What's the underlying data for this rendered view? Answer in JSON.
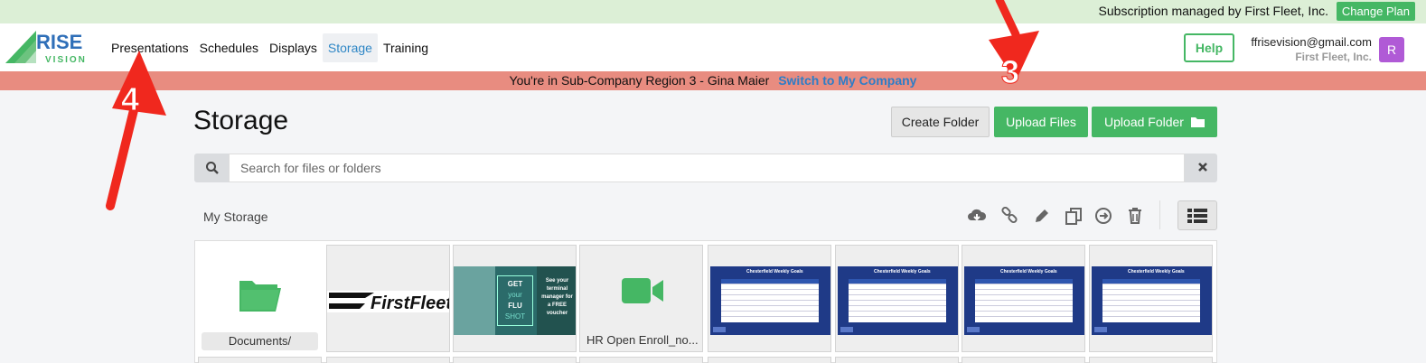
{
  "subscription": {
    "text": "Subscription managed by First Fleet, Inc.",
    "change_plan": "Change Plan"
  },
  "nav": {
    "logo": {
      "word1": "RISE",
      "word2": "VISION"
    },
    "links": [
      "Presentations",
      "Schedules",
      "Displays",
      "Storage",
      "Training"
    ],
    "active": "Storage",
    "help": "Help",
    "user_email": "ffrisevision@gmail.com",
    "user_company": "First Fleet, Inc.",
    "avatar_initial": "R"
  },
  "subcompany": {
    "text": "You're in Sub-Company Region 3 - Gina Maier",
    "switch_link": "Switch to My Company"
  },
  "page": {
    "title": "Storage",
    "create_folder": "Create Folder",
    "upload_files": "Upload Files",
    "upload_folder": "Upload Folder"
  },
  "search": {
    "placeholder": "Search for files or folders"
  },
  "breadcrumb": "My Storage",
  "toolbar_icons": [
    "cloud-download-icon",
    "link-icon",
    "pencil-icon",
    "copy-icon",
    "move-icon",
    "trash-icon",
    "list-view-icon"
  ],
  "files": [
    {
      "name": "Documents/",
      "kind": "folder"
    },
    {
      "name": "",
      "kind": "image-logo",
      "logo_text": "FirstFleet"
    },
    {
      "name": "",
      "kind": "image-flu",
      "text": [
        "GET",
        "your",
        "FLU",
        "SHOT"
      ],
      "side_text": "See your terminal manager for a FREE voucher"
    },
    {
      "name": "HR Open Enroll_no...",
      "kind": "video"
    },
    {
      "name": "",
      "kind": "image-sheet",
      "sheet_title": "Chesterfield Weekly Goals"
    },
    {
      "name": "",
      "kind": "image-sheet",
      "sheet_title": "Chesterfield Weekly Goals"
    },
    {
      "name": "",
      "kind": "image-sheet",
      "sheet_title": "Chesterfield Weekly Goals"
    },
    {
      "name": "",
      "kind": "image-sheet",
      "sheet_title": "Chesterfield Weekly Goals"
    }
  ],
  "annotations": [
    {
      "label": "3"
    },
    {
      "label": "4"
    }
  ],
  "colors": {
    "green": "#45b764",
    "blue_link": "#2f87c6",
    "banner_red": "#e88c80",
    "annotation_red": "#f0281e"
  }
}
